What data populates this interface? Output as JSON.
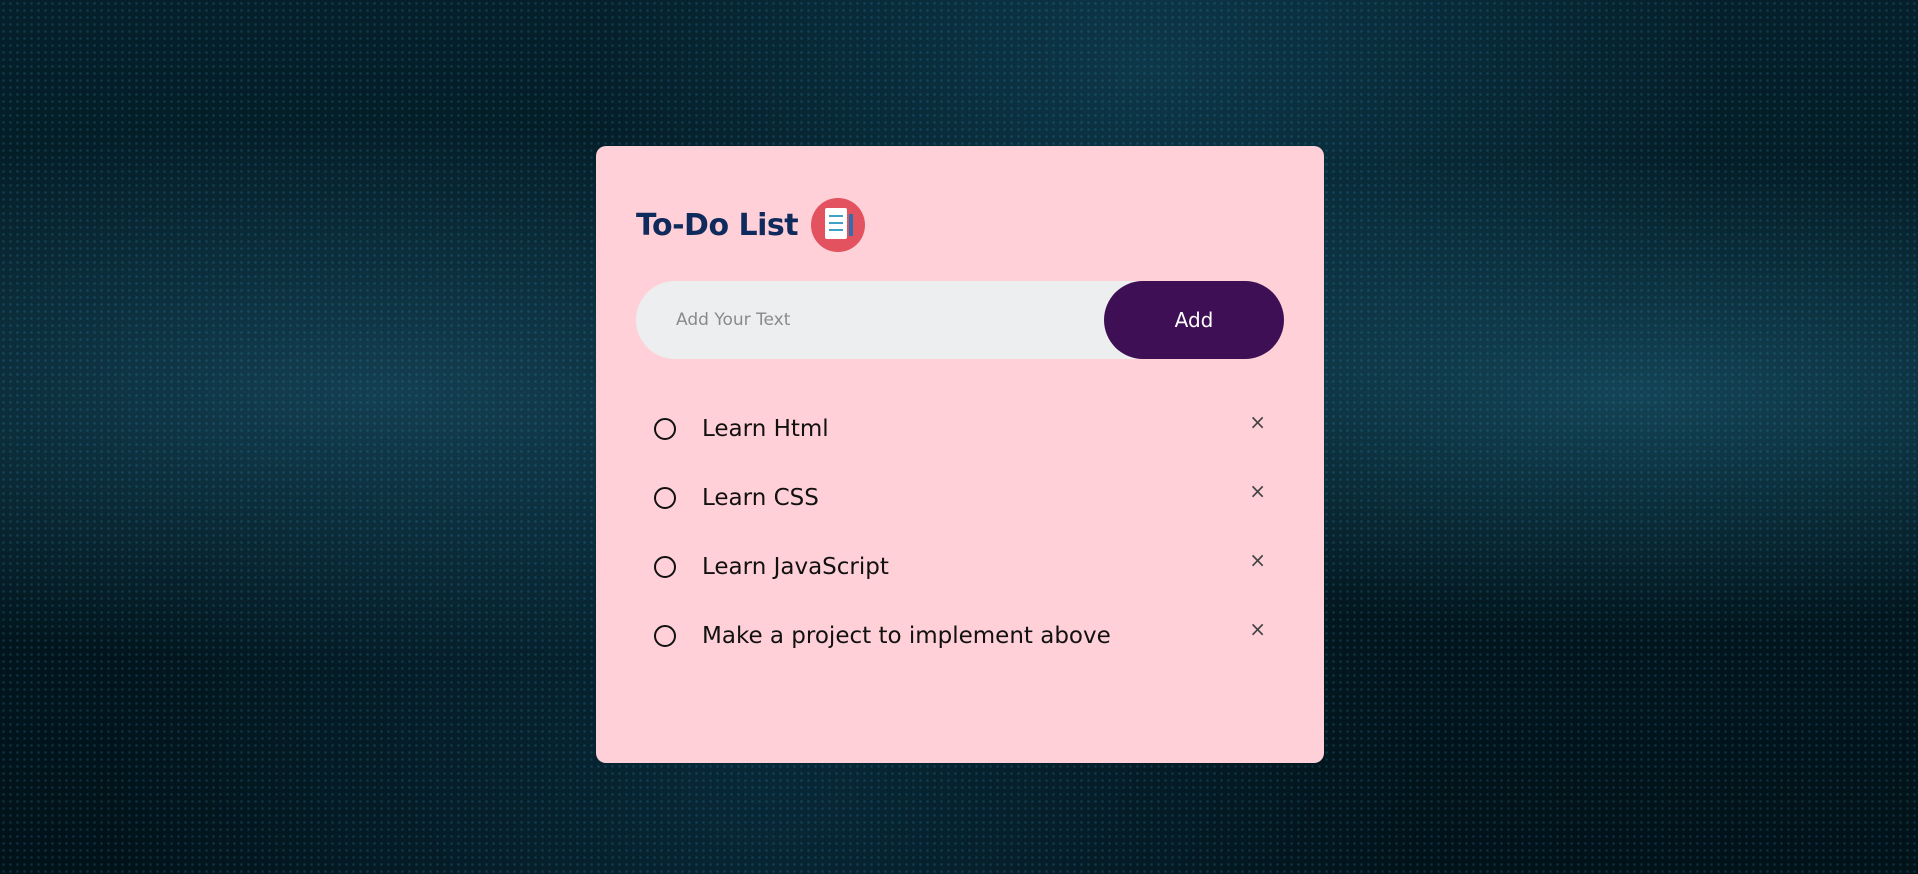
{
  "app": {
    "title": "To-Do List",
    "title_icon": "notepad-checklist-icon"
  },
  "input": {
    "value": "",
    "placeholder": "Add Your Text"
  },
  "actions": {
    "add_label": "Add"
  },
  "tasks": [
    {
      "text": "Learn Html",
      "checked": false,
      "remove_symbol": "×"
    },
    {
      "text": "Learn CSS",
      "checked": false,
      "remove_symbol": "×"
    },
    {
      "text": "Learn JavaScript",
      "checked": false,
      "remove_symbol": "×"
    },
    {
      "text": "Make a project to implement above",
      "checked": false,
      "remove_symbol": "×"
    }
  ],
  "colors": {
    "card_background": "#ffd0d8",
    "title_color": "#0f2a5c",
    "add_button_background": "#3f0f55",
    "input_background": "#edeef0",
    "icon_circle": "#e2525f"
  }
}
